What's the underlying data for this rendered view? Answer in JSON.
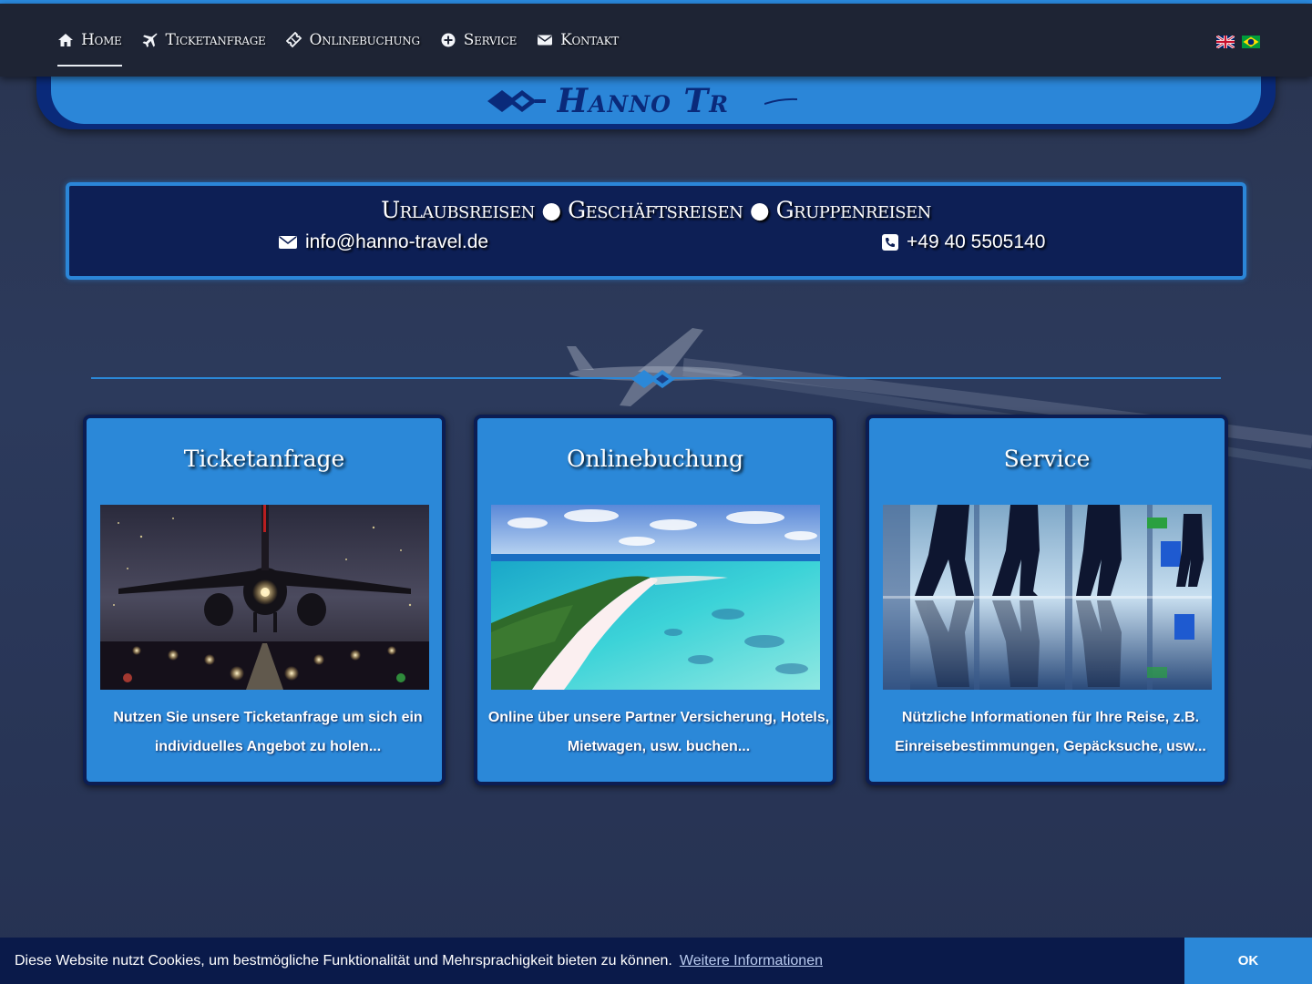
{
  "nav": {
    "items": [
      {
        "label": "Home",
        "icon": "home-icon",
        "active": true
      },
      {
        "label": "Ticketanfrage",
        "icon": "plane-icon",
        "active": false
      },
      {
        "label": "Onlinebuchung",
        "icon": "ticket-icon",
        "active": false
      },
      {
        "label": "Service",
        "icon": "plus-circle-icon",
        "active": false
      },
      {
        "label": "Kontakt",
        "icon": "envelope-icon",
        "active": false
      }
    ],
    "languages": [
      {
        "name": "English",
        "icon": "uk-flag-icon"
      },
      {
        "name": "Português",
        "icon": "brazil-flag-icon"
      }
    ]
  },
  "header": {
    "logo_text": "Hanno Tr"
  },
  "contact": {
    "tagline": "Urlaubsreisen ● Geschäftsreisen ● Gruppenreisen",
    "email": "info@hanno-travel.de",
    "phone": "+49 40 5505140"
  },
  "cards": [
    {
      "title": "Ticketanfrage",
      "text": "Nutzen Sie unsere Ticketanfrage um sich ein individuelles Angebot zu holen...",
      "image": "airplane-landing-night"
    },
    {
      "title": "Onlinebuchung",
      "text": "Online über unsere Partner Versicherung, Hotels, Mietwagen, usw. buchen...",
      "image": "tropical-beach-aerial"
    },
    {
      "title": "Service",
      "text": "Nützliche Informationen für Ihre Reise, z.B. Einreisebestimmungen, Gepäcksuche, usw...",
      "image": "airport-terminal-travelers"
    }
  ],
  "cookie": {
    "message": "Diese Website nutzt Cookies, um bestmögliche Funktionalität und Mehrsprachigkeit bieten zu können.",
    "link_label": "Weitere Informationen",
    "ok_label": "OK"
  },
  "colors": {
    "accent": "#2b88d8",
    "navy": "#0c1d52",
    "navbar": "#1e2434"
  }
}
